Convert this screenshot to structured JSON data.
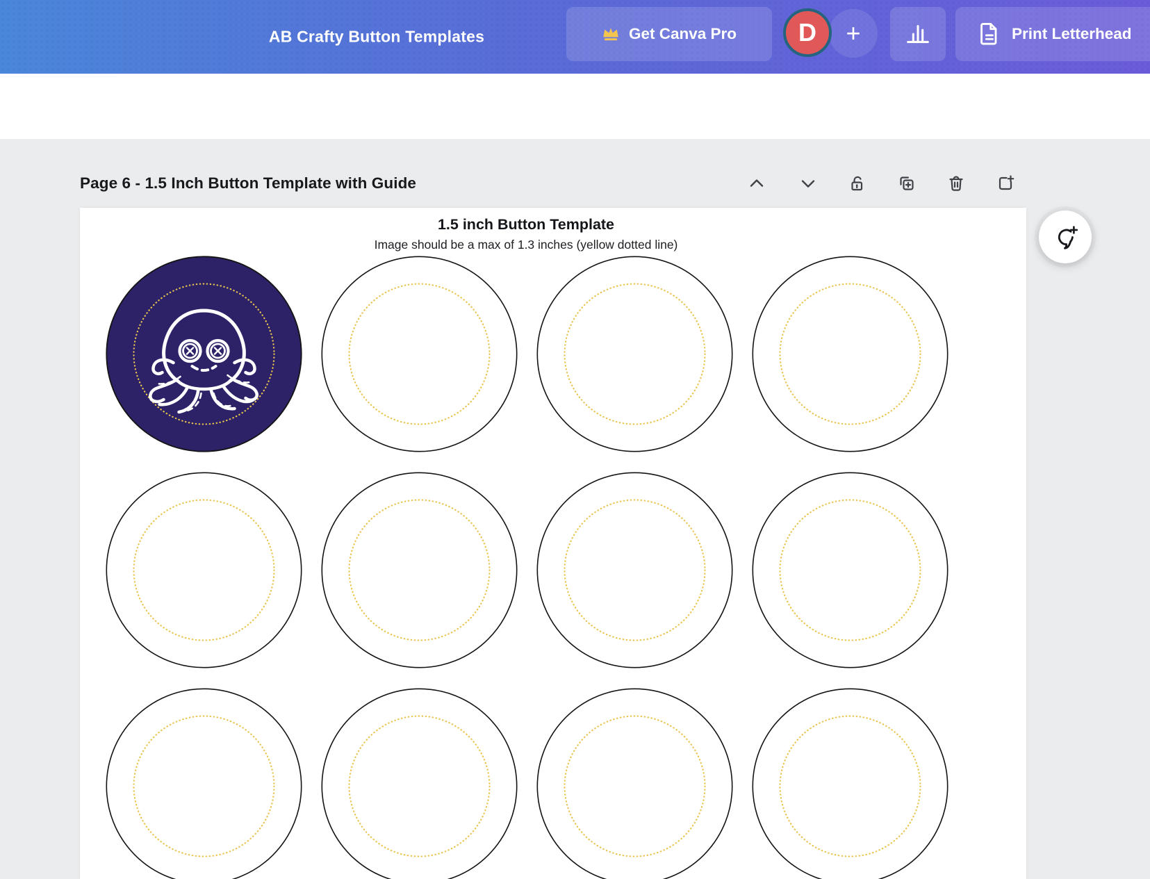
{
  "header": {
    "design_title": "AB Crafty Button Templates",
    "get_pro_label": "Get Canva Pro",
    "avatar_initial": "D",
    "add_label": "+",
    "print_label": "Print Letterhead",
    "icon_names": [
      "crown-icon",
      "bar-chart-icon",
      "document-icon"
    ]
  },
  "page_bar": {
    "title": "Page 6 - 1.5 Inch Button Template with Guide",
    "action_icon_names": [
      "chevron-up-icon",
      "chevron-down-icon",
      "unlock-icon",
      "duplicate-page-icon",
      "trash-icon",
      "add-page-icon"
    ]
  },
  "canvas": {
    "heading": "1.5 inch Button Template",
    "caption": "Image should be a max of 1.3 inches (yellow dotted line)",
    "grid": {
      "columns": 4,
      "rows": 3,
      "total_circles": 12,
      "filled_circle_index": 0,
      "filled_circle_artwork": "octopus-button-eyes-line-art"
    }
  },
  "floating": {
    "comment_icon_name": "add-comment-icon"
  },
  "colors": {
    "header_gradient_left": "#4a86d9",
    "header_gradient_right": "#6a5cd8",
    "pill_button_overlay": "rgba(255,255,255,0.14)",
    "avatar_bg": "#e15858",
    "avatar_ring": "#25647f",
    "crown_gold": "#f3c54e",
    "workspace_bg": "#ebecee",
    "canvas_bg": "#ffffff",
    "button_fill": "#2d2267",
    "guide_dotted_yellow": "#e8c44d",
    "circle_outline": "#141414",
    "toolbar_icon": "#3e4247"
  }
}
